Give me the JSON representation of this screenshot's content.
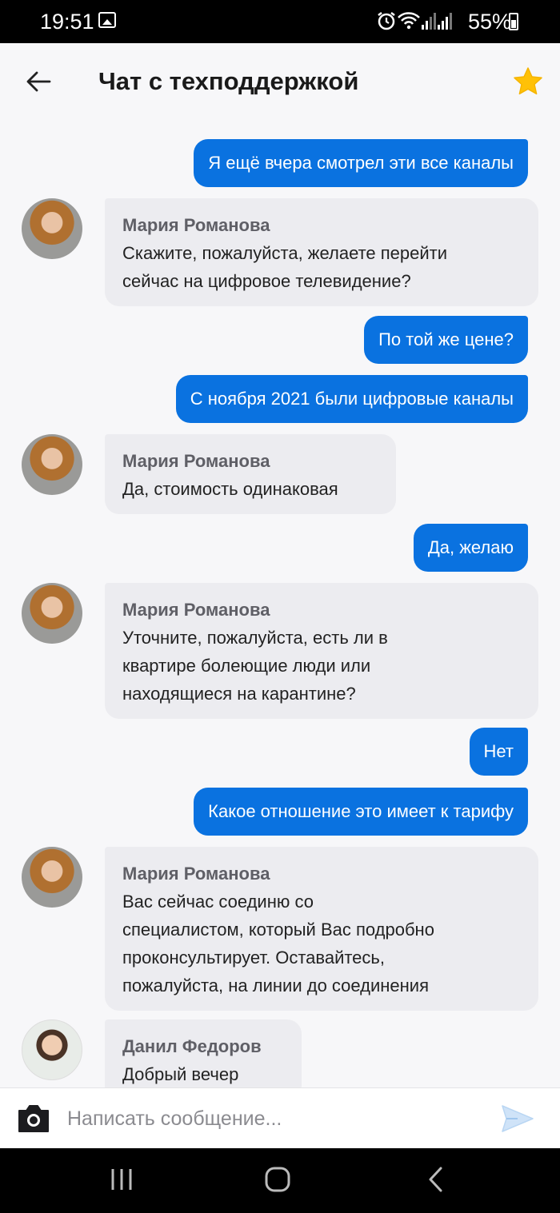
{
  "status_bar": {
    "time": "19:51",
    "battery": "55%",
    "icons": [
      "photo-icon",
      "alarm-icon",
      "wifi-icon",
      "signal-icon",
      "signal-icon",
      "battery-icon"
    ]
  },
  "header": {
    "title": "Чат с техподдержкой",
    "back_icon": "arrow-left-icon",
    "favorite_icon": "star-icon",
    "favorite_color": "#ffc107"
  },
  "colors": {
    "outgoing_bubble": "#0a72e0",
    "incoming_bubble": "#ececf0",
    "sender_name": "#5f5f66"
  },
  "messages": [
    {
      "type": "out",
      "text": "Я ещё вчера смотрел эти все каналы"
    },
    {
      "type": "in",
      "sender": "Мария Романова",
      "text": "Скажите, пожалуйста, желаете перейти\nсейчас на цифровое телевидение?"
    },
    {
      "type": "out",
      "text": "По той же цене?"
    },
    {
      "type": "out",
      "text": "С ноября 2021 были цифровые каналы"
    },
    {
      "type": "in",
      "sender": "Мария Романова",
      "text": "Да, стоимость одинаковая"
    },
    {
      "type": "out",
      "text": "Да, желаю"
    },
    {
      "type": "in",
      "sender": "Мария Романова",
      "text": "Уточните, пожалуйста, есть ли в\nквартире болеющие люди или\nнаходящиеся на карантине?"
    },
    {
      "type": "out",
      "text": "Нет"
    },
    {
      "type": "out",
      "text": "Какое отношение это имеет к тарифу"
    },
    {
      "type": "in",
      "sender": "Мария Романова",
      "text": "Вас сейчас соединю со\nспециалистом, который Вас подробно\nпроконсультирует. Оставайтесь,\nпожалуйста, на линии до соединения"
    },
    {
      "type": "in",
      "sender": "Данил Федоров",
      "text": "Добрый вечер"
    }
  ],
  "composer": {
    "placeholder": "Написать сообщение...",
    "camera_icon": "camera-icon",
    "send_icon": "send-icon"
  },
  "nav_bar": {
    "icons": [
      "recent-apps-icon",
      "home-icon",
      "back-icon"
    ]
  }
}
